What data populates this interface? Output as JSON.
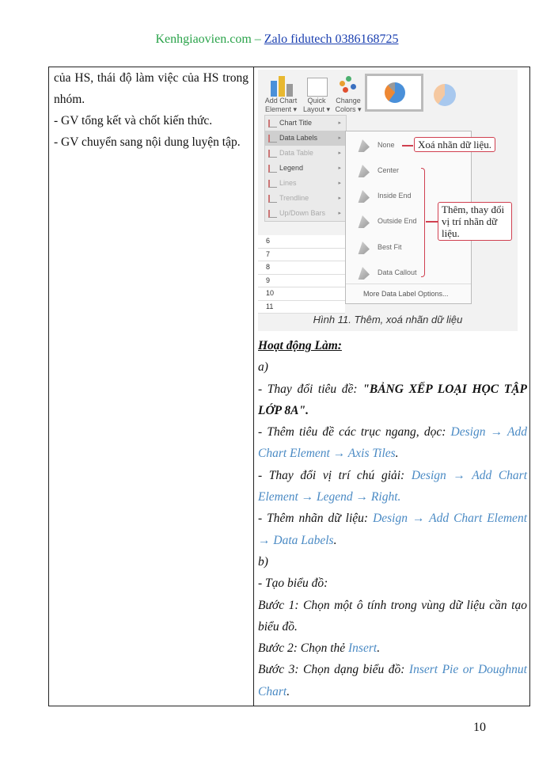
{
  "header": {
    "site": "Kenhgiaovien.com – ",
    "contact": "Zalo fidutech 0386168725"
  },
  "left_column": [
    "của HS, thái độ làm việc của HS trong nhóm.",
    "- GV tổng kết và chốt kiến thức.",
    "- GV chuyển sang nội dung luyện tập."
  ],
  "figure": {
    "ribbon": {
      "add_chart": "Add Chart Element ▾",
      "quick_layout": "Quick Layout ▾",
      "change_colors": "Change Colors ▾"
    },
    "menu": [
      {
        "label": "Chart Title"
      },
      {
        "label": "Data Labels"
      },
      {
        "label": "Data Table"
      },
      {
        "label": "Legend"
      },
      {
        "label": "Lines"
      },
      {
        "label": "Trendline"
      },
      {
        "label": "Up/Down Bars"
      }
    ],
    "rows": [
      "6",
      "7",
      "8",
      "9",
      "10",
      "11"
    ],
    "submenu": [
      "None",
      "Center",
      "Inside End",
      "Outside End",
      "Best Fit",
      "Data Callout"
    ],
    "more_options": "More Data Label Options...",
    "callout_remove": "Xoá nhãn dữ liệu.",
    "callout_add": "Thêm, thay đổi vị trí nhãn dữ liệu.",
    "caption": "Hình 11. Thêm, xoá nhãn dữ liệu",
    "colors": {
      "accent": "#d04050",
      "pie_blue": "#4a90d9",
      "pie_orange": "#ee8833"
    }
  },
  "right_column": {
    "heading": "Hoạt động Làm:",
    "a": "a)",
    "l1_text": "- Thay đổi tiêu đề: ",
    "l1_bold": "\"BẢNG XẾP LOẠI HỌC TẬP LỚP 8A\".",
    "l2_text": "- Thêm tiêu đề các trục ngang, dọc: ",
    "l2_link": "Design → Add Chart Element → Axis Tiles",
    "l3_text": "- Thay đổi vị trí chú giải: ",
    "l3_link": "Design → Add Chart Element → Legend → Right.",
    "l4_text": "- Thêm nhãn dữ liệu: ",
    "l4_link": "Design → Add Chart Element → Data Labels",
    "b": "b)",
    "create": "- Tạo biểu đồ:",
    "s1": "Bước 1: Chọn một ô tính trong vùng dữ liệu cần tạo biểu đồ.",
    "s2_text": "Bước 2: Chọn thẻ ",
    "s2_link": "Insert",
    "s3_text": "Bước 3: Chọn dạng biểu đồ: ",
    "s3_link": "Insert Pie or Doughnut Chart"
  },
  "page_number": "10"
}
